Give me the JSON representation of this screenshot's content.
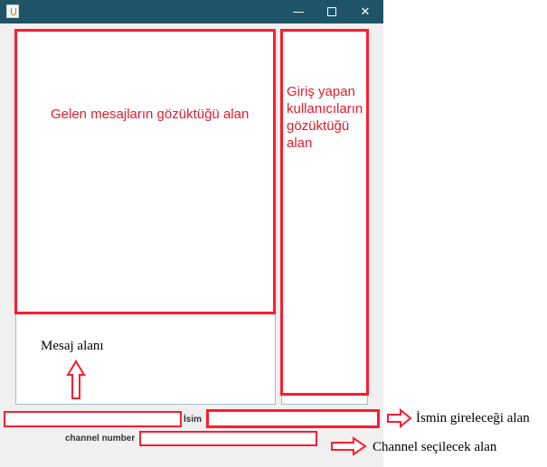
{
  "window": {
    "title": "",
    "controls": {
      "minimize": "—",
      "maximize": "",
      "close": "✕"
    }
  },
  "main": {
    "messages_area": {
      "annotation": "Gelen mesajların gözüktüğü alan"
    },
    "users_area": {
      "annotation": "Giriş yapan kullanıcıların gözüktüğü alan"
    },
    "message_input": {
      "annotation": "Mesaj alanı"
    }
  },
  "bottom": {
    "left_field": {
      "value": ""
    },
    "name_field": {
      "label": "İsim",
      "value": "",
      "annotation": "İsmin gireleceği alan"
    },
    "channel_field": {
      "label": "channel number",
      "value": "",
      "annotation": "Channel seçilecek alan"
    }
  },
  "colors": {
    "titlebar": "#1f5468",
    "annotation_red": "#ff1b2e",
    "window_bg": "#f0f0f0"
  },
  "icons": [
    "java-app-icon",
    "minimize-icon",
    "maximize-icon",
    "close-icon",
    "up-arrow-icon",
    "right-arrow-icon"
  ]
}
